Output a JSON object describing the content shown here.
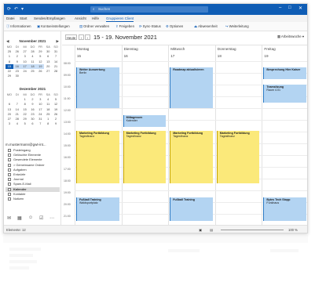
{
  "titlebar": {
    "search_placeholder": "Suchen"
  },
  "menu": [
    "Datei",
    "Start",
    "Senden/Empfangen",
    "Ansicht",
    "Hilfe",
    "Gruppieren Client"
  ],
  "ribbon": [
    "Informationen",
    "Kontoeinstellungen",
    "Ordner verwalten",
    "Freigeben",
    "Sync-Status",
    "Optionen",
    "Abwesenheit",
    "Weiterleitung"
  ],
  "calendar": {
    "new_label": "Heute",
    "range": "15 - 19. November 2021",
    "view_label": "Arbeitswoche",
    "days": [
      {
        "name": "Montag",
        "num": "15"
      },
      {
        "name": "Dienstag",
        "num": "16"
      },
      {
        "name": "Mittwoch",
        "num": "17"
      },
      {
        "name": "Donnerstag",
        "num": "18"
      },
      {
        "name": "Freitag",
        "num": "19"
      }
    ],
    "times": [
      "08:00",
      "09:00",
      "10:00",
      "11:00",
      "12:00",
      "13:00",
      "14:00",
      "15:00",
      "16:00",
      "17:00",
      "18:00",
      "19:00",
      "20:00",
      "21:00"
    ],
    "events": [
      {
        "title": "Weiter Auswertung",
        "sub": "Berlin"
      },
      {
        "title": "Roadmap aktualisieren",
        "sub": ""
      },
      {
        "title": "Besprechung Hier Kaiser",
        "sub": ""
      },
      {
        "title": "Teamsitzung",
        "sub": "Raum 4.01"
      },
      {
        "title": "Mittagessen",
        "sub": "Kalender"
      },
      {
        "title": "Marketing Fortbildung",
        "sub": "Tagesfinanz"
      },
      {
        "title": "Marketing Fortbildung",
        "sub": "Tagesfinanz"
      },
      {
        "title": "Marketing Fortbildung",
        "sub": "Tagesfinanz"
      },
      {
        "title": "Marketing Fortbildung",
        "sub": "Tagesfinanz"
      },
      {
        "title": "Fußball Training",
        "sub": "Waldsportplatz"
      },
      {
        "title": "Fußball Training",
        "sub": ""
      },
      {
        "title": "Bytes Tech Stopp",
        "sub": "Funkhaus"
      }
    ]
  },
  "minical": {
    "nov": {
      "title": "November 2021",
      "days_header": [
        "MO",
        "DI",
        "MI",
        "DO",
        "FR",
        "SA",
        "SO"
      ],
      "cells": [
        "25",
        "26",
        "27",
        "28",
        "29",
        "30",
        "31",
        "1",
        "2",
        "3",
        "4",
        "5",
        "6",
        "7",
        "8",
        "9",
        "10",
        "11",
        "12",
        "13",
        "14",
        "15",
        "16",
        "17",
        "18",
        "19",
        "20",
        "21",
        "22",
        "23",
        "24",
        "25",
        "26",
        "27",
        "28",
        "29",
        "30"
      ]
    },
    "dec": {
      "title": "Dezember 2021",
      "days_header": [
        "MO",
        "DI",
        "MI",
        "DO",
        "FR",
        "SA",
        "SO"
      ],
      "cells": [
        "",
        "",
        "1",
        "2",
        "3",
        "4",
        "5",
        "6",
        "7",
        "8",
        "9",
        "10",
        "11",
        "12",
        "13",
        "14",
        "15",
        "16",
        "17",
        "18",
        "19",
        "20",
        "21",
        "22",
        "23",
        "24",
        "25",
        "26",
        "27",
        "28",
        "29",
        "30",
        "31",
        "1",
        "2",
        "3",
        "4",
        "5",
        "6",
        "7",
        "8",
        "9"
      ]
    }
  },
  "account": "m.mustermann@gwt-int...",
  "folders": [
    "Posteingang",
    "Gelöschte Elemente",
    "Gesendete Elemente",
    "> Gemeinsame Ordner",
    "Aufgaben",
    "Entwürfe",
    "Journal",
    "Spam-E-Mail",
    "Kalender",
    "Kontakte",
    "Notizen"
  ],
  "status": {
    "left": "Elemente: 12",
    "zoom": "100 %"
  }
}
